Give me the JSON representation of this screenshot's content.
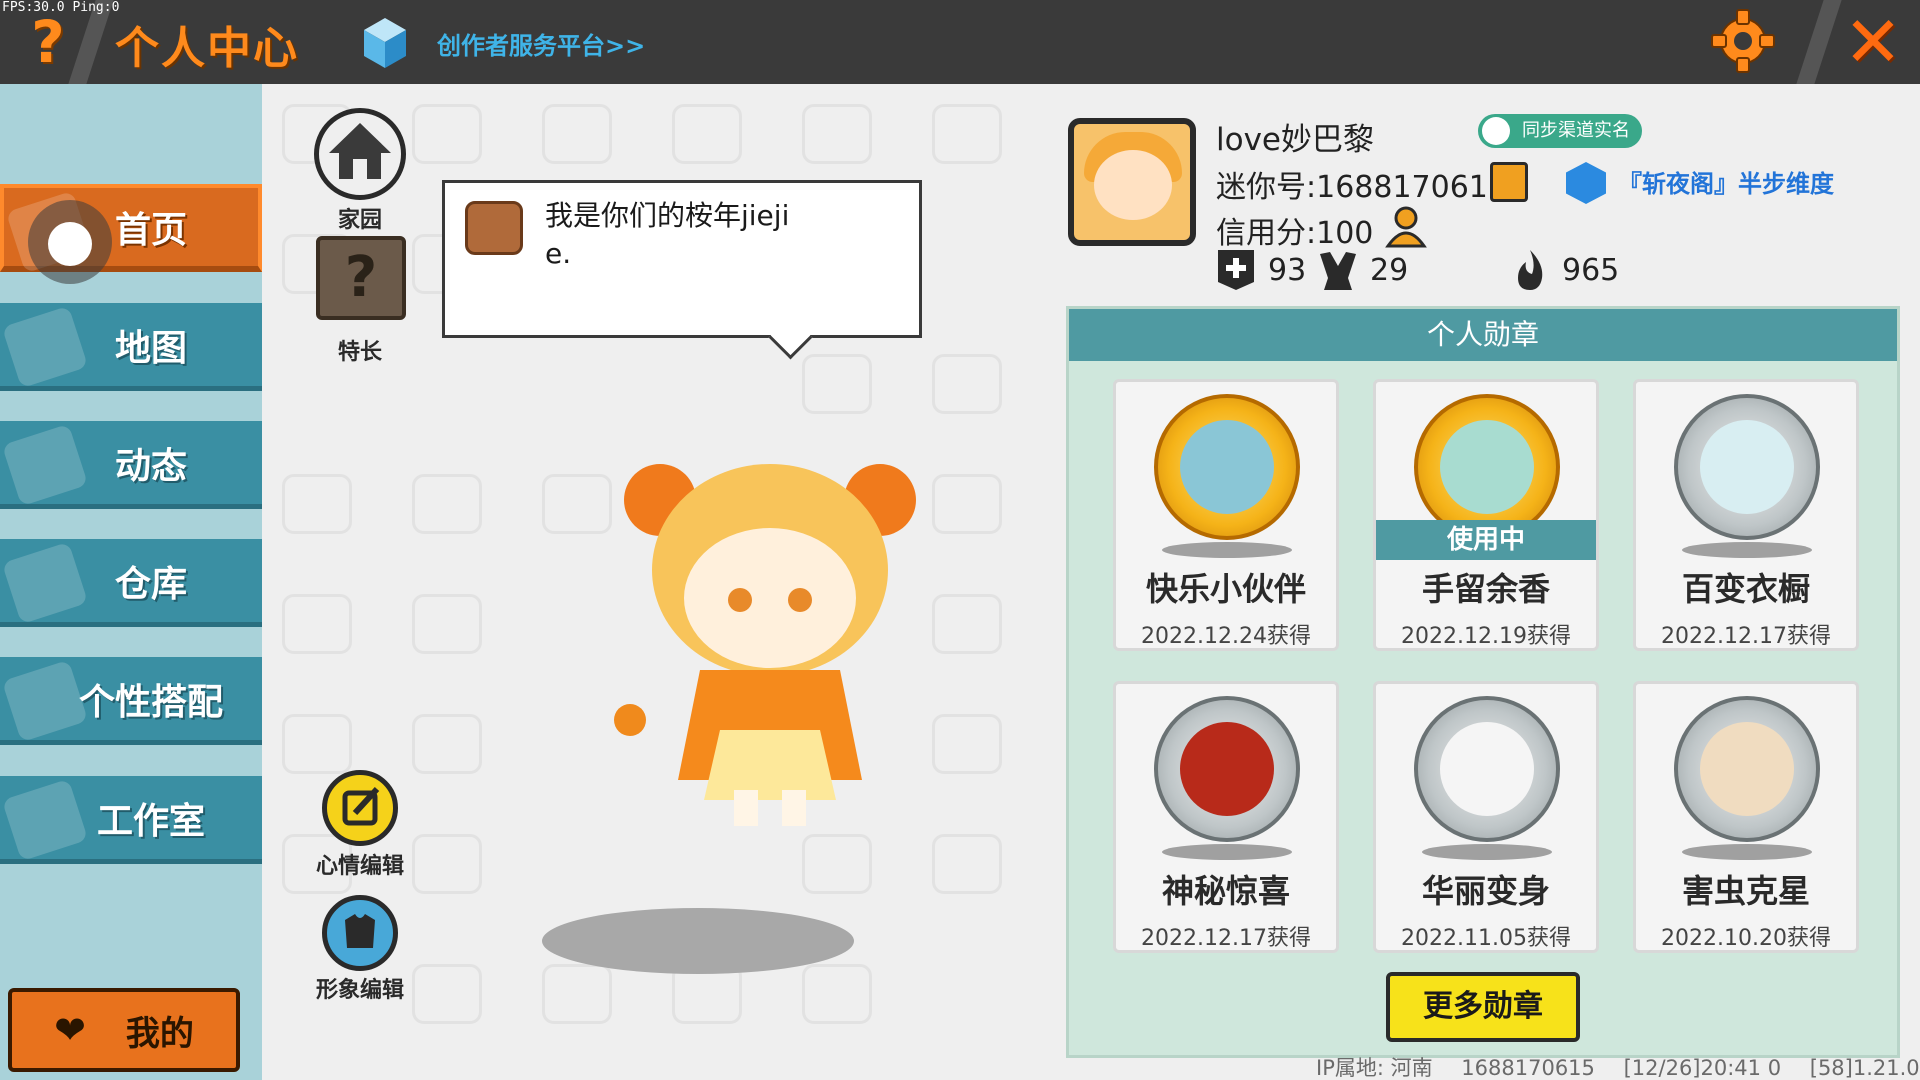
{
  "debug": {
    "fps": "FPS:30.0  Ping:0"
  },
  "header": {
    "help_glyph": "?",
    "title": "个人中心",
    "creator_link": "创作者服务平台>>",
    "close_glyph": "✕",
    "accent_color": "#ff8a1c"
  },
  "sidebar": {
    "items": [
      {
        "label": "首页",
        "icon": "home-ghost-icon",
        "active": true
      },
      {
        "label": "地图",
        "icon": "map-ghost-icon",
        "active": false
      },
      {
        "label": "动态",
        "icon": "bell-ghost-icon",
        "active": false
      },
      {
        "label": "仓库",
        "icon": "house-ghost-icon",
        "active": false
      },
      {
        "label": "个性搭配",
        "icon": "outfit-ghost-icon",
        "active": false
      },
      {
        "label": "工作室",
        "icon": "studio-ghost-icon",
        "active": false
      }
    ],
    "mine_button": "我的"
  },
  "tools": {
    "home_label": "家园",
    "skill_label": "特长",
    "skill_glyph": "?",
    "mood_label": "心情编辑",
    "look_label": "形象编辑"
  },
  "speech": {
    "text": "我是你们的桉年jiejie."
  },
  "profile": {
    "username": "love妙巴黎",
    "sync_badge": "同步渠道实名",
    "mini_id": "迷你号:1688170615",
    "clan": "『斩夜阁』半步维度",
    "credit": "信用分:100",
    "stats": [
      {
        "icon": "add-friend-icon",
        "value": "93"
      },
      {
        "icon": "fans-icon",
        "value": "29"
      },
      {
        "icon": "flame-icon",
        "value": "965"
      }
    ]
  },
  "medals": {
    "header": "个人勋章",
    "in_use_label": "使用中",
    "items": [
      {
        "name": "快乐小伙伴",
        "date": "2022.12.24获得",
        "tier": "gold",
        "in_use": false
      },
      {
        "name": "手留余香",
        "date": "2022.12.19获得",
        "tier": "gold",
        "in_use": true
      },
      {
        "name": "百变衣橱",
        "date": "2022.12.17获得",
        "tier": "silver",
        "in_use": false
      },
      {
        "name": "神秘惊喜",
        "date": "2022.12.17获得",
        "tier": "silver",
        "in_use": false
      },
      {
        "name": "华丽变身",
        "date": "2022.11.05获得",
        "tier": "silver",
        "in_use": false
      },
      {
        "name": "害虫克星",
        "date": "2022.10.20获得",
        "tier": "silver",
        "in_use": false
      }
    ],
    "more_button": "更多勋章"
  },
  "footer": {
    "ip": "IP属地: 河南",
    "uid": "1688170615",
    "time": "[12/26]20:41 0",
    "version": "[58]1.21.0"
  }
}
